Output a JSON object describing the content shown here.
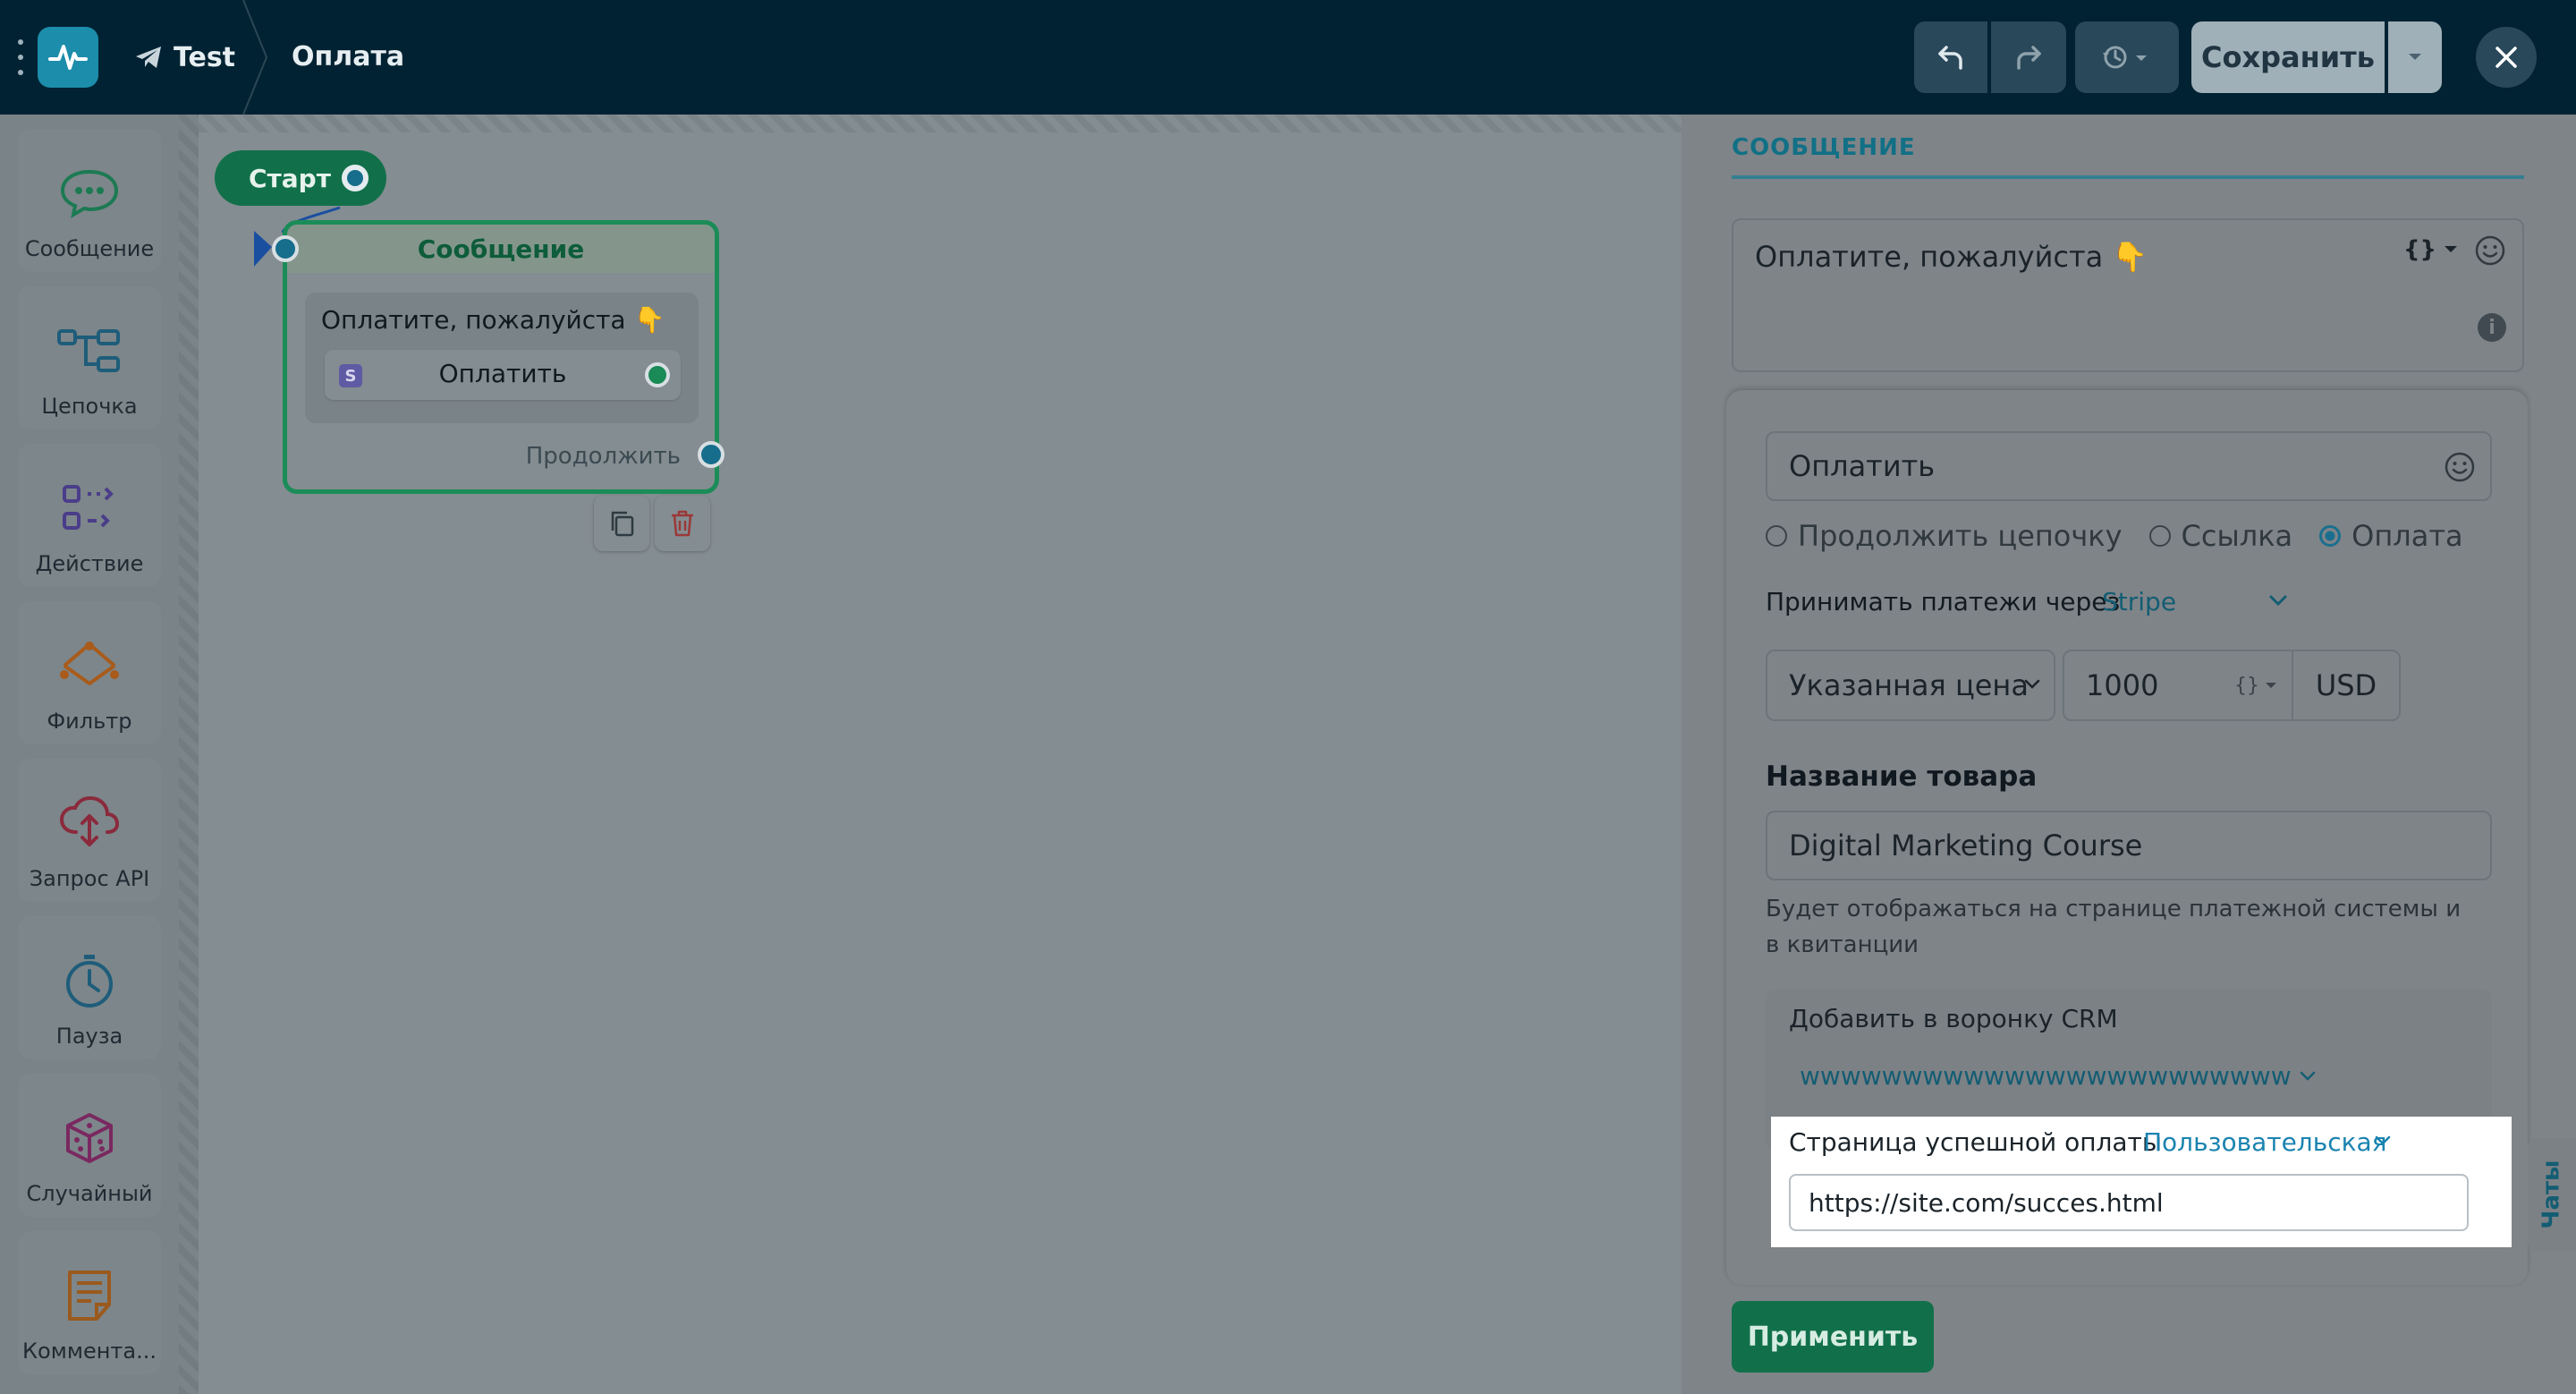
{
  "topbar": {
    "bot_name": "Test",
    "page_title": "Оплата",
    "save_label": "Сохранить"
  },
  "sidebar": {
    "items": [
      {
        "label": "Сообщение",
        "icon": "chat-bubble-icon"
      },
      {
        "label": "Цепочка",
        "icon": "flow-chain-icon"
      },
      {
        "label": "Действие",
        "icon": "action-icon"
      },
      {
        "label": "Фильтр",
        "icon": "filter-icon"
      },
      {
        "label": "Запрос API",
        "icon": "cloud-api-icon"
      },
      {
        "label": "Пауза",
        "icon": "clock-icon"
      },
      {
        "label": "Случайный",
        "icon": "dice-icon"
      },
      {
        "label": "Коммента...",
        "icon": "note-icon"
      }
    ]
  },
  "canvas": {
    "start_label": "Старт",
    "node": {
      "title": "Сообщение",
      "text": "Оплатите, пожалуйста 👇",
      "button_label": "Оплатить",
      "button_badge": "S",
      "continue_label": "Продолжить"
    }
  },
  "panel": {
    "tab_label": "СООБЩЕНИЕ",
    "message_text": "Оплатите, пожалуйста 👇",
    "vars_glyph": "{}",
    "button_text": "Оплатить",
    "action_options": [
      {
        "label": "Продолжить цепочку",
        "selected": false
      },
      {
        "label": "Ссылка",
        "selected": false
      },
      {
        "label": "Оплата",
        "selected": true
      }
    ],
    "pay_via_label": "Принимать платежи через",
    "pay_provider": "Stripe",
    "price_type": "Указанная цена",
    "amount": "1000",
    "currency": "USD",
    "product_label": "Название товара",
    "product_name": "Digital Marketing Course",
    "product_hint": "Будет отображаться на странице платежной системы и в квитанции",
    "crm_label": "Добавить в воронку CRM",
    "crm_value": "wwwwwwwwwwwwwwwwwwwwwwwwwwwwwwwwwwww",
    "success_label": "Страница успешной оплаты",
    "success_type": "Пользовательская",
    "success_url": "https://site.com/succes.html",
    "apply_label": "Применить",
    "chats_label": "Чаты"
  },
  "colors": {
    "topbar": "#002232",
    "accent_green": "#11704a",
    "accent_teal": "#1c8dab",
    "link_blue": "#1a83b0"
  }
}
